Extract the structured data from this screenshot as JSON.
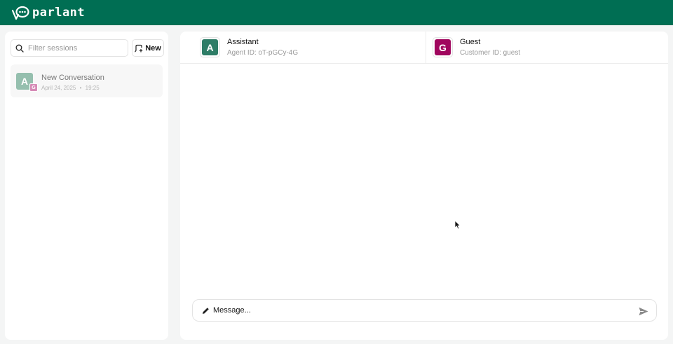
{
  "brand": {
    "name": "parlant",
    "color": "#006e53"
  },
  "sidebar": {
    "filter_placeholder": "Filter sessions",
    "new_label": "New",
    "sessions": [
      {
        "title": "New Conversation",
        "date": "April 24, 2025",
        "separator": "•",
        "time": "19:25",
        "agent_initial": "A",
        "customer_initial": "G"
      }
    ]
  },
  "header": {
    "agent": {
      "initial": "A",
      "name": "Assistant",
      "id_label": "Agent ID: oT-pGCy-4G",
      "color": "#2e7d67"
    },
    "customer": {
      "initial": "G",
      "name": "Guest",
      "id_label": "Customer ID: guest",
      "color": "#a0065e"
    }
  },
  "composer": {
    "placeholder": "Message...",
    "icon": "pencil-icon",
    "send_icon": "send-icon"
  }
}
